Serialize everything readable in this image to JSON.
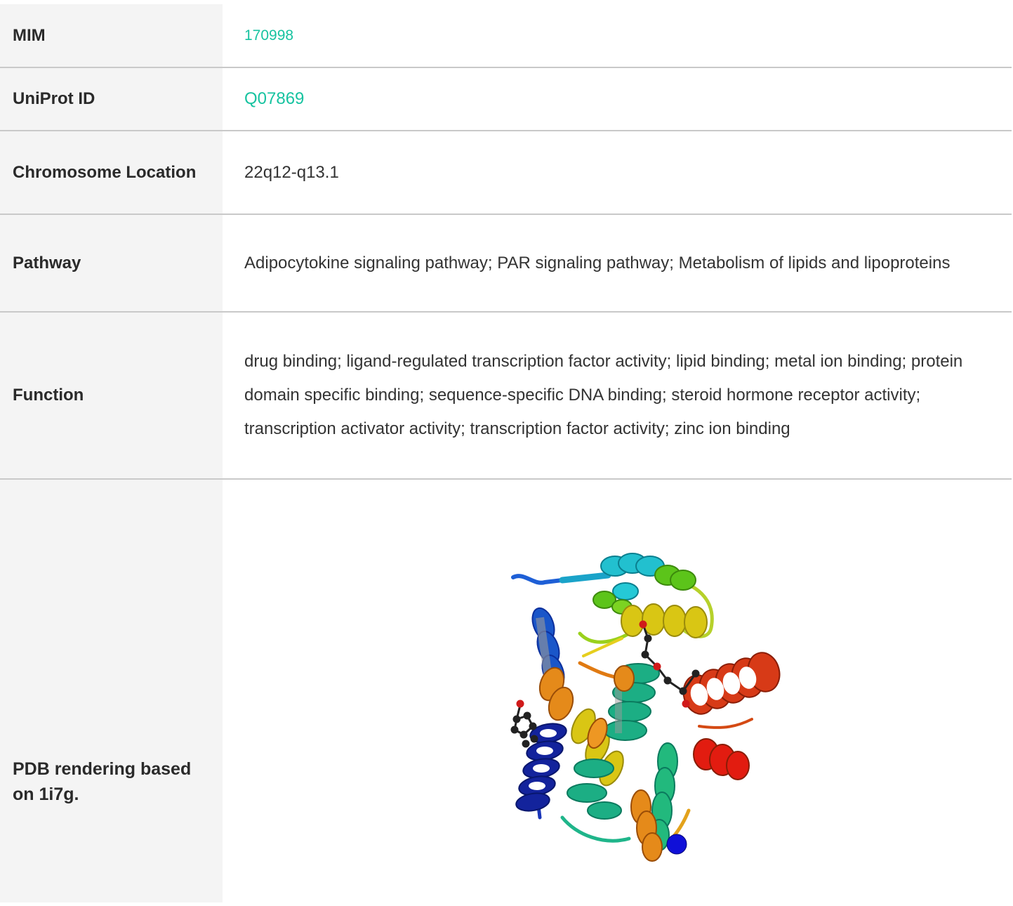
{
  "rows": {
    "mim": {
      "label": "MIM",
      "value": "170998"
    },
    "uniprot": {
      "label": "UniProt ID",
      "value": "Q07869"
    },
    "chromosome": {
      "label": "Chromosome Location",
      "value": "22q12-q13.1"
    },
    "pathway": {
      "label": "Pathway",
      "value": "Adipocytokine signaling pathway; PAR signaling pathway; Metabolism of lipids and lipoproteins"
    },
    "function": {
      "label": "Function",
      "value": "drug binding; ligand-regulated transcription factor activity; lipid binding; metal ion binding; protein domain specific binding; sequence-specific DNA binding; steroid hormone receptor activity; transcription activator activity; transcription factor activity; zinc ion binding"
    },
    "pdb": {
      "label": "PDB rendering based on 1i7g.",
      "image": "protein-ribbon-structure"
    }
  },
  "colors": {
    "link": "#17c3a0",
    "label_bg": "#f4f4f4",
    "divider": "#c9c9c9"
  }
}
